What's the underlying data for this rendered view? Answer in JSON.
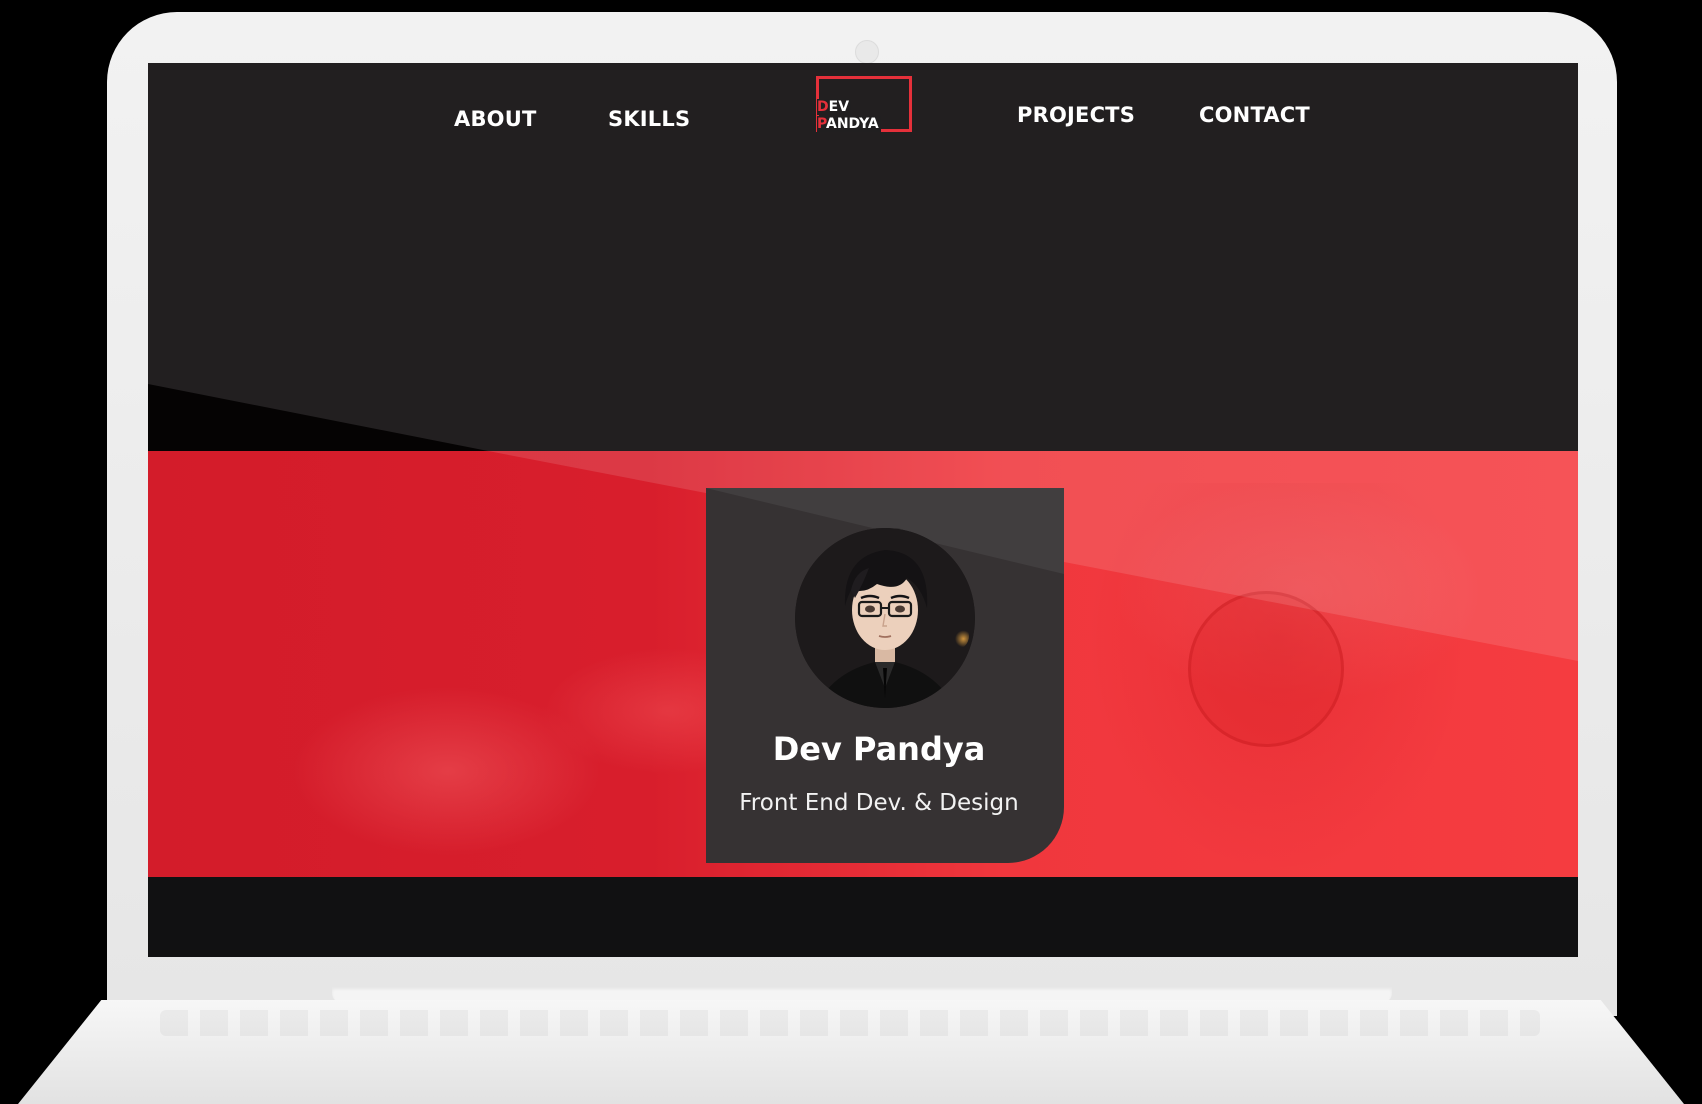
{
  "nav": {
    "items": [
      {
        "label": "ABOUT"
      },
      {
        "label": "SKILLS"
      },
      {
        "label": "PROJECTS"
      },
      {
        "label": "CONTACT"
      }
    ]
  },
  "logo": {
    "line1_initial": "D",
    "line1_rest": "EV",
    "line2_initial": "P",
    "line2_rest": "ANDYA"
  },
  "profile": {
    "name": "Dev Pandya",
    "role": "Front End Dev. & Design"
  },
  "colors": {
    "accent": "#e5303a",
    "page_dark": "#211f20",
    "card_bg": "#363233",
    "band_red": "#f03a3e",
    "footer_strip": "#111112"
  },
  "icons": {
    "avatar": "anime-portrait-avatar"
  }
}
